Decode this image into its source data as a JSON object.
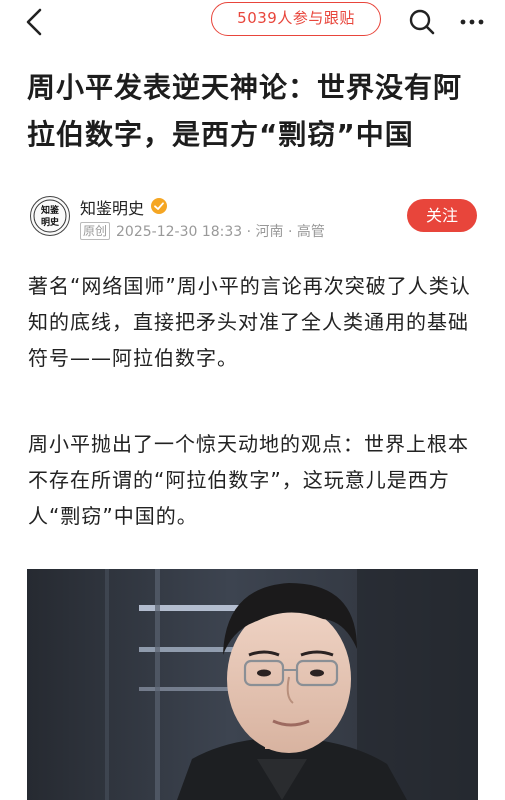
{
  "header": {
    "participants_label": "5039人参与跟贴",
    "back_icon": "chevron-left-icon",
    "search_icon": "search-icon",
    "more_icon": "more-dots-icon"
  },
  "article": {
    "title": "周小平发表逆天神论：世界没有阿拉伯数字，是西方“剽窃”中国",
    "author": {
      "name": "知鉴明史",
      "avatar_text": "知鉴明史",
      "original_tag": "原创",
      "meta": "2025-12-30 18:33 · 河南 · 高管",
      "follow_label": "关注"
    },
    "paragraphs": [
      "著名“网络国师”周小平的言论再次突破了人类认知的底线，直接把矛头对准了全人类通用的基础符号——阿拉伯数字。",
      "周小平抛出了一个惊天动地的观点：世界上根本不存在所谓的“阿拉伯数字”，这玩意儿是西方人“剽窃”中国的。"
    ]
  },
  "colors": {
    "accent": "#e8453b",
    "verified": "#f5a623",
    "text": "#222222",
    "muted": "#999999"
  }
}
